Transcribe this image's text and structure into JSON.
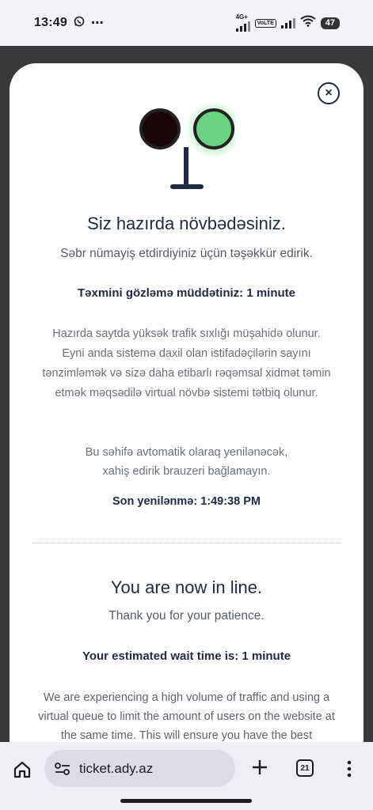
{
  "status_bar": {
    "time": "13:49",
    "network_label": "4G+",
    "volte_label": "VoLTE",
    "battery": "47"
  },
  "modal": {
    "close_symbol": "×",
    "az": {
      "title": "Siz hazırda növbədəsiniz.",
      "thanks": "Səbr nümayiş etdirdiyiniz üçün təşəkkür edirik.",
      "wait": "Təxmini gözləmə müddətiniz: 1 minute",
      "info": "Hazırda saytda yüksək trafik sıxlığı müşahidə olunur. Eyni anda sistemə daxil olan istifadəçilərin sayını tənzimləmək və sizə daha etibarlı rəqəmsal xidmət təmin etmək məqsədilə virtual növbə sistemi tətbiq olunur.",
      "refresh_line1": "Bu səhifə avtomatik olaraq yenilənəcək,",
      "refresh_line2": "xahiş edirik brauzeri bağlamayın.",
      "last_update": "Son yenilənmə: 1:49:38 PM"
    },
    "en": {
      "title": "You are now in line.",
      "thanks": "Thank you for your patience.",
      "wait": "Your estimated wait time is: 1 minute",
      "info": "We are experiencing a high volume of traffic and using a virtual queue to limit the amount of users on the website at the same time. This will ensure you have the best"
    },
    "traffic_light": {
      "red_color": "#1a0508",
      "green_color": "#6bd37f"
    }
  },
  "browser": {
    "url": "ticket.ady.az",
    "tab_count": "21"
  }
}
